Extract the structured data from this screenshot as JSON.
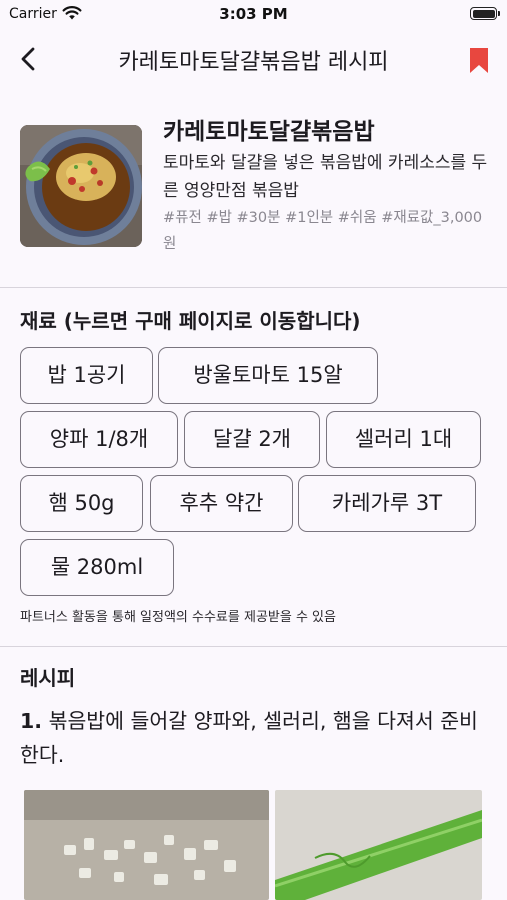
{
  "status_bar": {
    "carrier": "Carrier",
    "time": "3:03 PM"
  },
  "app_bar": {
    "title": "카레토마토달걀볶음밥 레시피"
  },
  "summary": {
    "name": "카레토마토달걀볶음밥",
    "description": "토마토와 달걀을 넣은 볶음밥에 카레소스를 두른 영양만점 볶음밥",
    "tags": "#퓨전 #밥 #30분 #1인분 #쉬움 #재료값_3,000원"
  },
  "ingredients": {
    "title": "재료 (누르면 구매 페이지로 이동합니다)",
    "items": [
      {
        "label": "밥 1공기"
      },
      {
        "label": "방울토마토 15알"
      },
      {
        "label": "양파 1/8개"
      },
      {
        "label": "달걀 2개"
      },
      {
        "label": "셀러리 1대"
      },
      {
        "label": "햄 50g"
      },
      {
        "label": "후추 약간"
      },
      {
        "label": "카레가루 3T"
      },
      {
        "label": "물 280ml"
      }
    ],
    "partner_note": "파트너스 활동을 통해 일정액의 수수료를 제공받을 수 있음"
  },
  "recipe": {
    "title": "레시피",
    "steps": [
      {
        "number": "1.",
        "text": " 볶음밥에 들어갈 양파와, 셀러리, 햄을 다져서 준비한다."
      }
    ]
  },
  "icons": {
    "back": "chevron-left-icon",
    "bookmark": "bookmark-icon",
    "wifi": "wifi-icon",
    "battery": "battery-icon"
  },
  "colors": {
    "background": "#fbf8fd",
    "bookmark": "#e8473f",
    "chip_border": "#7a757f",
    "tag_text": "#8a8790"
  }
}
